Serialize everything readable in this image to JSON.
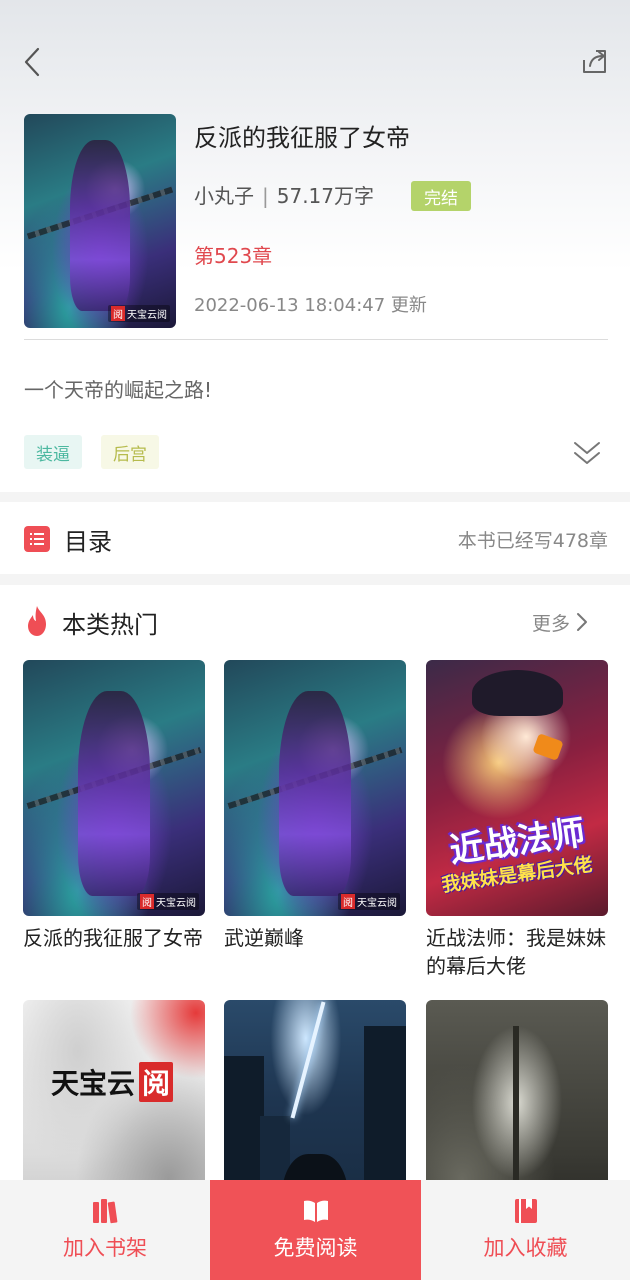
{
  "book": {
    "title": "反派的我征服了女帝",
    "author": "小丸子",
    "word_count": "57.17万字",
    "status": "完结",
    "latest_chapter": "第523章",
    "update_time": "2022-06-13 18:04:47 更新",
    "summary": "一个天帝的崛起之路!",
    "tags": [
      "装逼",
      "后宫"
    ],
    "cover_watermark": "天宝云阅"
  },
  "catalog": {
    "title": "目录",
    "count_text": "本书已经写478章"
  },
  "hot": {
    "title": "本类热门",
    "more": "更多",
    "books": [
      {
        "title": "反派的我征服了女帝"
      },
      {
        "title": "武逆巅峰"
      },
      {
        "title": "近战法师：我是妹妹的幕后大佬"
      },
      {
        "title": ""
      },
      {
        "title": ""
      },
      {
        "title": ""
      }
    ],
    "cover_text": {
      "anime_title": "近战法师",
      "anime_subtitle": "我妹妹是幕后大佬",
      "logo_text": "天宝云",
      "logo_box": "阅"
    }
  },
  "bottom_bar": {
    "shelf": "加入书架",
    "read": "免费阅读",
    "favorite": "加入收藏"
  },
  "colors": {
    "accent": "#ef4e55",
    "status_badge": "#b4d36a",
    "chapter_red": "#e0484e"
  }
}
